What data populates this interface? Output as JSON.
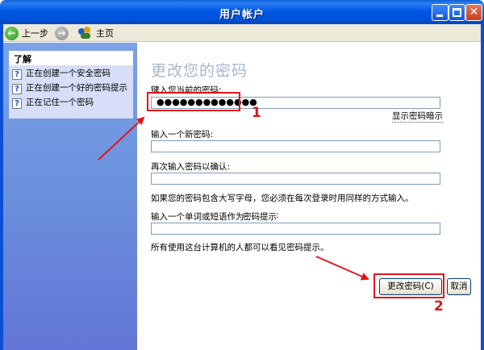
{
  "window": {
    "title": "用户帐户"
  },
  "toolbar": {
    "back_label": "上一步",
    "home_label": "主页"
  },
  "sidebar": {
    "learn_title": "了解",
    "items": [
      {
        "label": "正在创建一个安全密码"
      },
      {
        "label": "正在创建一个好的密码提示"
      },
      {
        "label": "正在记住一个密码"
      }
    ]
  },
  "main": {
    "heading": "更改您的密码",
    "current_password_label": "键入您当前的密码:",
    "current_password_value": "●●●●●●●●●●●●●",
    "show_hint_link": "显示密码暗示",
    "new_password_label": "输入一个新密码:",
    "new_password_value": "",
    "confirm_label": "再次输入密码以确认:",
    "confirm_value": "",
    "case_note": "如果您的密码包含大写字母，您必须在每次登录时用同样的方式输入。",
    "hint_label": "输入一个单词或短语作为",
    "hint_link": "密码提示",
    "hint_value": "",
    "visibility_note": "所有使用这台计算机的人都可以看见密码提示。",
    "change_button": "更改密码(C)",
    "cancel_button": "取消"
  },
  "annotations": {
    "step1": "1",
    "step2": "2",
    "color": "#e3151a"
  }
}
